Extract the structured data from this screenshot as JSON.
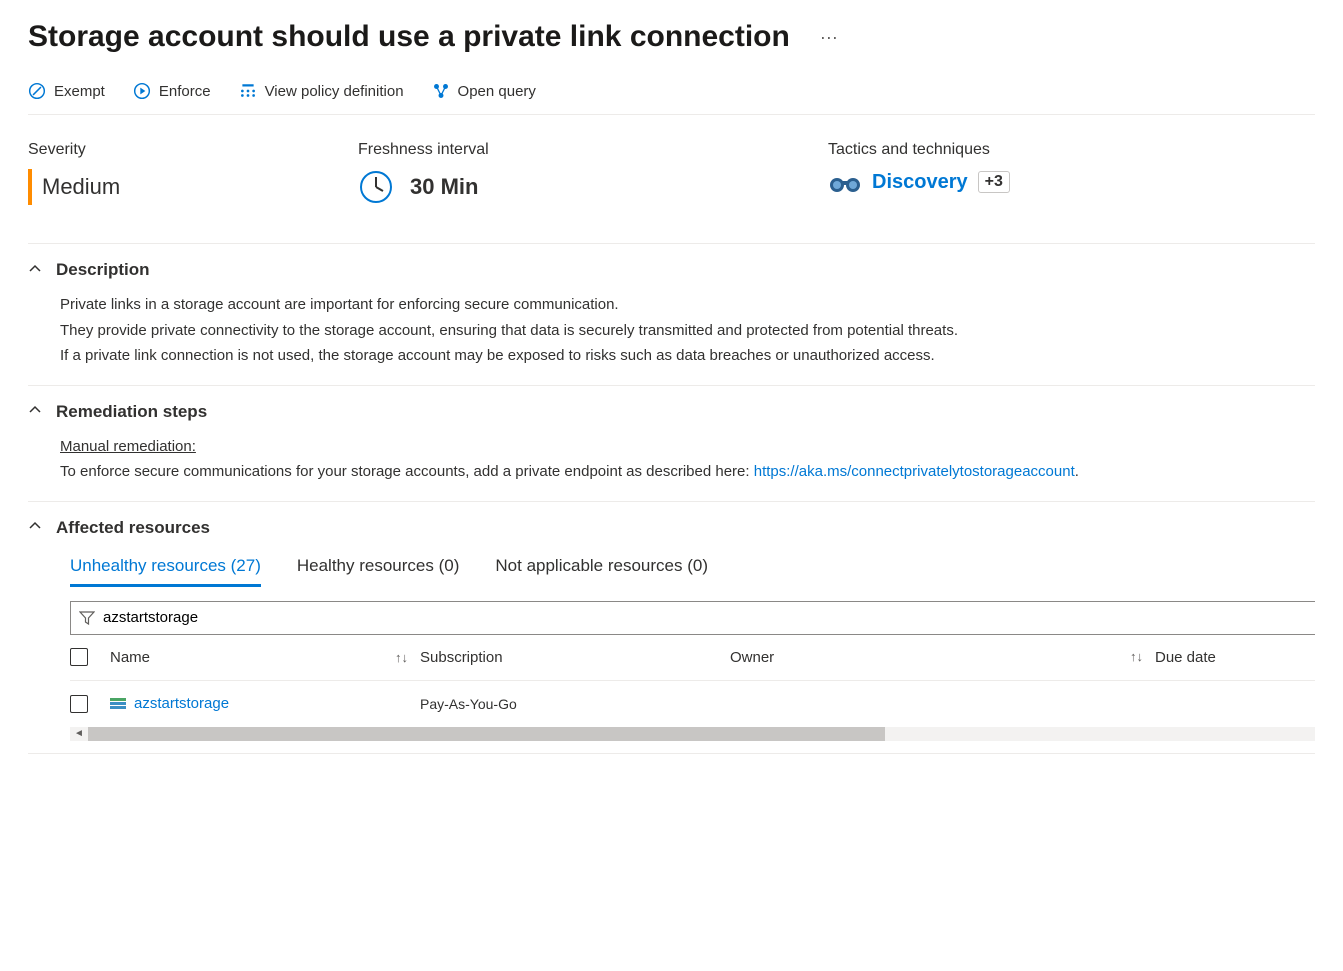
{
  "title": "Storage account should use a private link connection",
  "toolbar": {
    "exempt": "Exempt",
    "enforce": "Enforce",
    "view_policy": "View policy definition",
    "open_query": "Open query"
  },
  "info": {
    "severity_label": "Severity",
    "severity_value": "Medium",
    "freshness_label": "Freshness interval",
    "freshness_value": "30 Min",
    "tactics_label": "Tactics and techniques",
    "tactics_value": "Discovery",
    "tactics_more": "+3"
  },
  "sections": {
    "description_title": "Description",
    "description_lines": [
      "Private links in a storage account are important for enforcing secure communication.",
      "They provide private connectivity to the storage account, ensuring that data is securely transmitted and protected from potential threats.",
      "If a private link connection is not used, the storage account may be exposed to risks such as data breaches or unauthorized access."
    ],
    "remediation_title": "Remediation steps",
    "remediation_subtitle": "Manual remediation:",
    "remediation_text": "To enforce secure communications for your storage accounts, add a private endpoint as described here: ",
    "remediation_link": "https://aka.ms/connectprivatelytostorageaccount",
    "affected_title": "Affected resources"
  },
  "tabs": {
    "unhealthy": "Unhealthy resources (27)",
    "healthy": "Healthy resources (0)",
    "na": "Not applicable resources (0)"
  },
  "filter": {
    "value": "azstartstorage"
  },
  "table": {
    "columns": {
      "name": "Name",
      "subscription": "Subscription",
      "owner": "Owner",
      "due_date": "Due date"
    },
    "rows": [
      {
        "name": "azstartstorage",
        "subscription": "Pay-As-You-Go",
        "owner": "",
        "due_date": ""
      }
    ]
  }
}
